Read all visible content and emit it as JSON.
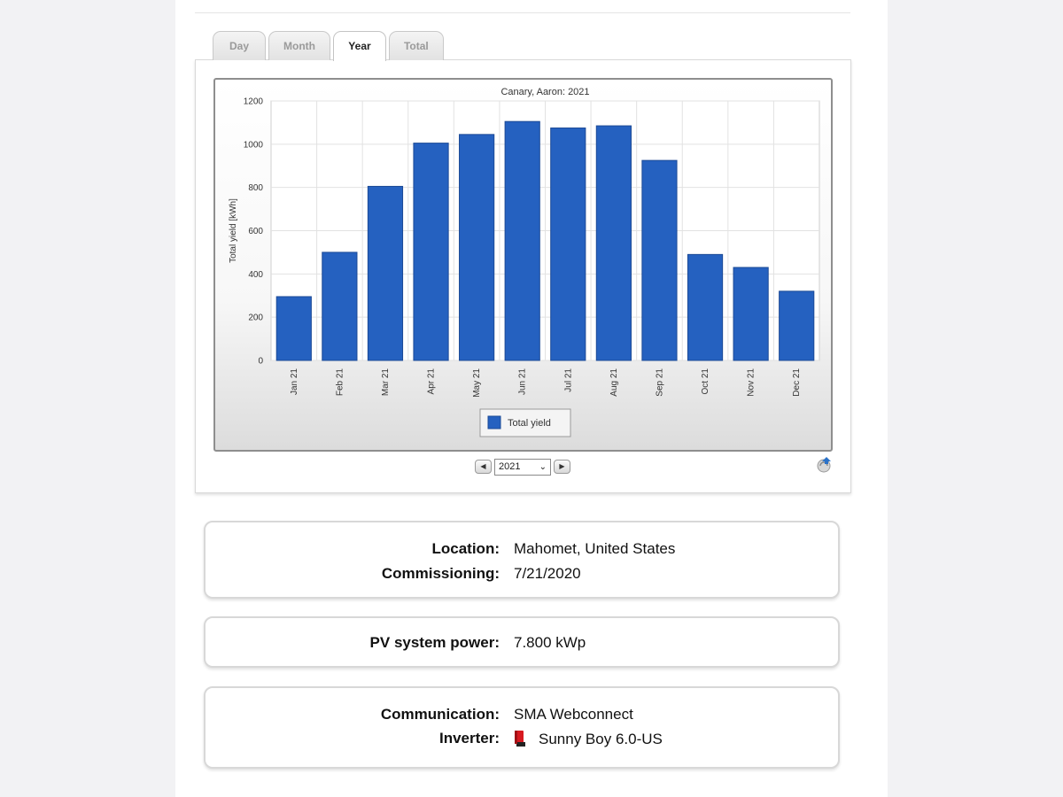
{
  "tabs": [
    {
      "label": "Day",
      "active": false
    },
    {
      "label": "Month",
      "active": false
    },
    {
      "label": "Year",
      "active": true
    },
    {
      "label": "Total",
      "active": false
    }
  ],
  "colors": {
    "bar": "#2561c0",
    "bar_edge": "#1c4a96",
    "grid": "#e2e2e2"
  },
  "chart_data": {
    "type": "bar",
    "title": "Canary, Aaron: 2021",
    "ylabel": "Total yield [kWh]",
    "xlabel": "",
    "ylim": [
      0,
      1200
    ],
    "yticks": [
      "0",
      "200",
      "400",
      "600",
      "800",
      "1000",
      "1200"
    ],
    "categories": [
      "Jan 21",
      "Feb 21",
      "Mar 21",
      "Apr 21",
      "May 21",
      "Jun 21",
      "Jul 21",
      "Aug 21",
      "Sep 21",
      "Oct 21",
      "Nov 21",
      "Dec 21"
    ],
    "series": [
      {
        "name": "Total yield",
        "values": [
          295,
          500,
          805,
          1005,
          1045,
          1105,
          1075,
          1085,
          925,
          490,
          430,
          320
        ]
      }
    ],
    "grid": true,
    "legend": "bottom-center"
  },
  "year_nav": {
    "selected_year": "2021",
    "prev_icon": "triangle-left-icon",
    "next_icon": "triangle-right-icon"
  },
  "info": {
    "location_label": "Location:",
    "location_value": "Mahomet, United States",
    "commissioning_label": "Commissioning:",
    "commissioning_value": "7/21/2020",
    "power_label": "PV system power:",
    "power_value": "7.800 kWp",
    "communication_label": "Communication:",
    "communication_value": "SMA Webconnect",
    "inverter_label": "Inverter:",
    "inverter_value": "Sunny Boy 6.0-US",
    "inverter_icon": "inverter-icon"
  }
}
